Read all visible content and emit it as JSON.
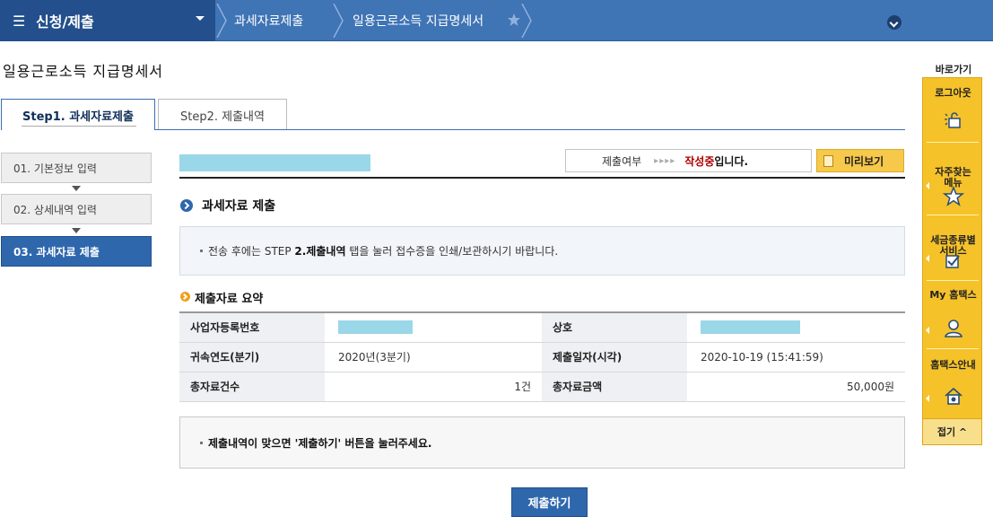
{
  "topbar": {
    "menu_title": "신청/제출",
    "breadcrumbs": [
      "과세자료제출",
      "일용근로소득 지급명세서"
    ]
  },
  "page": {
    "title": "일용근로소득 지급명세서"
  },
  "tabs": {
    "step1": "Step1. 과세자료제출",
    "step2": "Step2. 제출내역"
  },
  "steps": [
    {
      "label": "01. 기본정보 입력"
    },
    {
      "label": "02. 상세내역 입력"
    },
    {
      "label": "03. 과세자료 제출"
    }
  ],
  "status": {
    "label": "제출여부",
    "arrows": "▸▸▸▸",
    "value": "작성중",
    "suffix": "입니다.",
    "preview_label": "미리보기"
  },
  "section": {
    "title": "과세자료 제출",
    "notice_pre": "전송 후에는 STEP ",
    "notice_bold": "2.제출내역",
    "notice_post": " 탭을 눌러 접수증을 인쇄/보관하시기 바랍니다."
  },
  "summary": {
    "title": "제출자료 요약",
    "rows": [
      {
        "h1": "사업자등록번호",
        "v1": "",
        "h2": "상호",
        "v2": ""
      },
      {
        "h1": "귀속연도(분기)",
        "v1": "2020년(3분기)",
        "h2": "제출일자(시각)",
        "v2": "2020-10-19 (15:41:59)"
      },
      {
        "h1": "총자료건수",
        "v1": "1건",
        "h2": "총자료금액",
        "v2": "50,000원"
      }
    ]
  },
  "confirm": {
    "text": "제출내역이 맞으면 '제출하기' 버튼을 눌러주세요."
  },
  "submit_label": "제출하기",
  "quick": {
    "title": "바로가기",
    "items": [
      {
        "label": "로그아웃",
        "icon": "lock-icon"
      },
      {
        "label": "자주찾는\n메뉴",
        "icon": "star-icon"
      },
      {
        "label": "세금종류별\n서비스",
        "icon": "checkbox-icon"
      },
      {
        "label": "My 홈택스",
        "icon": "person-icon"
      },
      {
        "label": "홈택스안내",
        "icon": "house-info-icon"
      }
    ],
    "close_label": "접기 ^"
  },
  "colors": {
    "nav_bg": "#3f74b5",
    "nav_dark": "#234f8c",
    "accent_blue": "#2f67ad",
    "quick_yellow": "#f5c22a",
    "status_red": "#b00000",
    "redaction": "#9ad7e8"
  }
}
